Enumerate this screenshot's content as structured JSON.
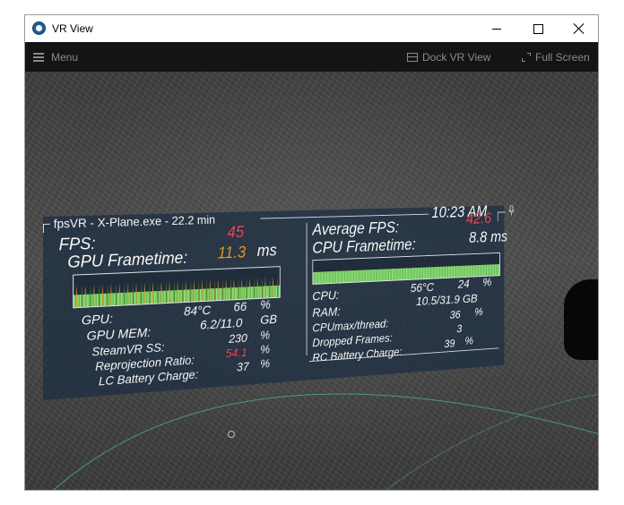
{
  "window": {
    "title": "VR View",
    "app_icon": "steamvr-icon"
  },
  "window_controls": {
    "minimize_icon": "minimize-icon",
    "maximize_icon": "maximize-icon",
    "close_icon": "close-icon"
  },
  "menubar": {
    "menu_label": "Menu",
    "dock_label": "Dock VR View",
    "fullscreen_label": "Full Screen"
  },
  "hud": {
    "title": "fpsVR - X-Plane.exe - 22.2 min",
    "time": "10:23 AM",
    "left": {
      "fps_label": "FPS:",
      "fps_value": "45",
      "gpu_frametime_label": "GPU Frametime:",
      "gpu_frametime_value": "11.3",
      "ms_unit": "ms",
      "gpu_label": "GPU:",
      "gpu_temp": "84°C",
      "gpu_load": "66",
      "pct": "%",
      "gpu_mem_label": "GPU MEM:",
      "gpu_mem_value": "6.2/11.0",
      "gb_unit": "GB",
      "ss_label": "SteamVR SS:",
      "ss_value": "230",
      "reproj_label": "Reprojection Ratio:",
      "reproj_value": "54.1",
      "lc_label": "LC Battery Charge:",
      "lc_value": "37"
    },
    "right": {
      "avg_fps_label": "Average FPS:",
      "avg_fps_value": "42.6",
      "cpu_frametime_label": "CPU Frametime:",
      "cpu_frametime_value": "8.8 ms",
      "cpu_label": "CPU:",
      "cpu_temp": "56°C",
      "cpu_load": "24",
      "pct": "%",
      "ram_label": "RAM:",
      "ram_value": "10.5/31.9 GB",
      "cpumax_label": "CPUmax/thread:",
      "cpumax_value": "36",
      "dropped_label": "Dropped Frames:",
      "dropped_value": "3",
      "rc_label": "RC Battery Charge:",
      "rc_value": "39"
    },
    "colors": {
      "panel_bg": "#1e2e42",
      "fps_value": "#e4505a",
      "gpu_frametime_value": "#e69a2a",
      "reproj_value": "#e4505a",
      "graph_green": "#7fd16a"
    }
  }
}
